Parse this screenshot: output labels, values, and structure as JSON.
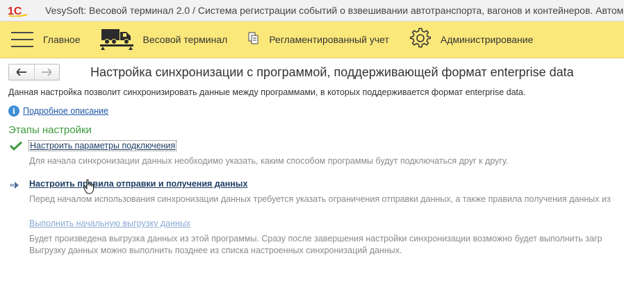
{
  "window": {
    "title": "VesySoft: Весовой терминал 2.0 / Система регистрации событий о взвешивании автотранспорта, вагонов и контейнеров. Автоматизация"
  },
  "sections": {
    "main_label": "Главное",
    "scale_label": "Весовой терминал",
    "reg_label": "Регламентированный учет",
    "admin_label": "Администрирование"
  },
  "nav": {
    "back": "🡐",
    "forward": "🡒"
  },
  "page": {
    "title": "Настройка синхронизации с программой, поддерживающей формат enterprise data",
    "description": "Данная настройка позволит синхронизировать данные между программами, в которых поддерживается формат enterprise data.",
    "info_link": "Подробное описание",
    "stages_title": "Этапы настройки"
  },
  "steps": [
    {
      "link": "Настроить параметры подключения",
      "text": "Для начала синхронизации данных необходимо указать, каким способом программы будут подключаться друг к другу."
    },
    {
      "link": "Настроить правила отправки и получения данных",
      "text": "Перед началом использования синхронизации данных требуется указать ограничения отправки данных, а также правила получения данных из"
    },
    {
      "link": "Выполнить начальную выгрузку данных",
      "text_line1": "Будет произведена выгрузка данных из этой программы. Сразу после завершения настройки синхронизации возможно будет выполнить загр",
      "text_line2": "Выгрузку данных можно выполнить позднее из списка настроенных синхронизаций данных."
    }
  ],
  "colors": {
    "sections_bg": "#fbe87a",
    "stages_green": "#3d9a3d",
    "link_dark": "#1f3f66",
    "link_disabled": "#8aa9d4",
    "hint_gray": "#8a8a8a"
  }
}
